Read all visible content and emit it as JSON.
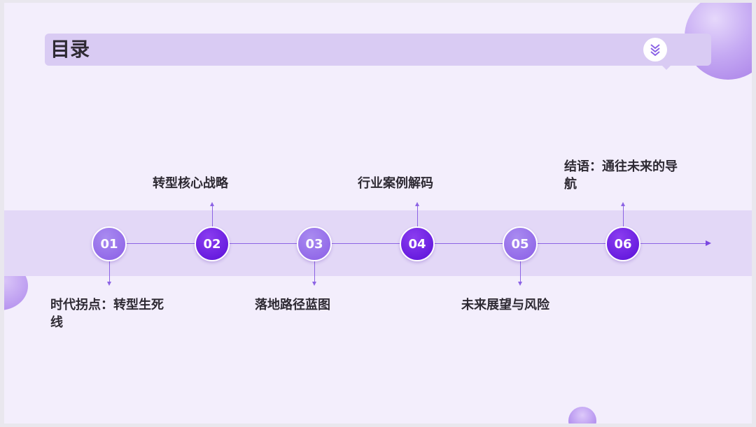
{
  "title": "目录",
  "title_icon": "double-chevron-down-icon",
  "colors": {
    "accent_light": "#8a5ee6",
    "accent_dark": "#5a10d8",
    "band": "#e3d8f7",
    "title_bar": "#d9cbf3"
  },
  "items": [
    {
      "number": "01",
      "label": "时代拐点：转型生死线"
    },
    {
      "number": "02",
      "label": "转型核心战略"
    },
    {
      "number": "03",
      "label": "落地路径蓝图"
    },
    {
      "number": "04",
      "label": "行业案例解码"
    },
    {
      "number": "05",
      "label": "未来展望与风险"
    },
    {
      "number": "06",
      "label": "结语：通往未来的导航"
    }
  ]
}
